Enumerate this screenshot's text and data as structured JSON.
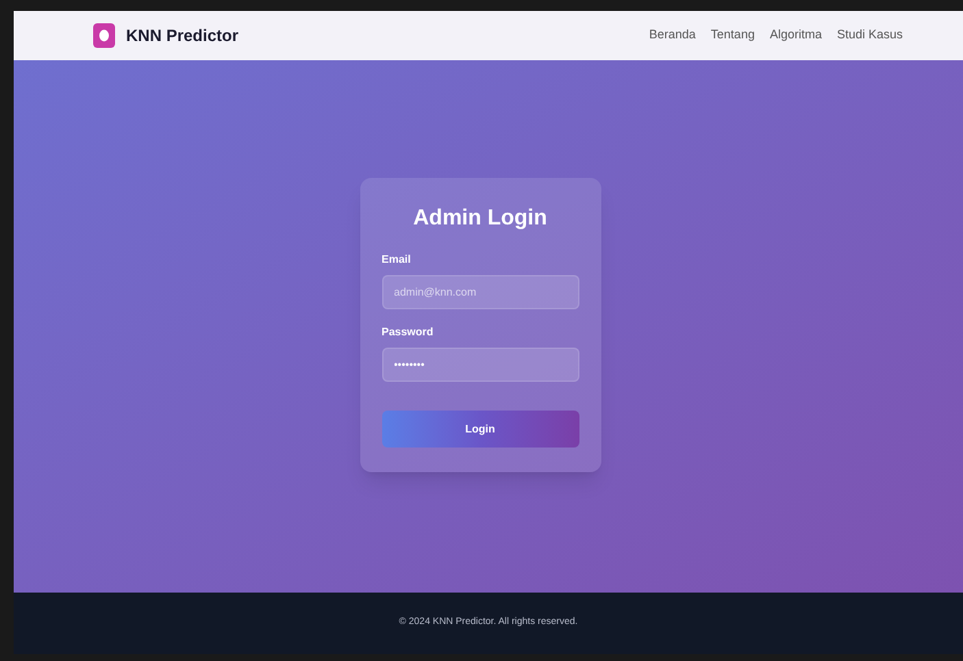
{
  "brand": {
    "name": "KNN Predictor"
  },
  "nav": [
    {
      "label": "Beranda"
    },
    {
      "label": "Tentang"
    },
    {
      "label": "Algoritma"
    },
    {
      "label": "Studi Kasus"
    }
  ],
  "login": {
    "title": "Admin Login",
    "fields": [
      {
        "label": "Email",
        "placeholder": "admin@knn.com"
      },
      {
        "label": "Password",
        "value": "••••••••"
      }
    ],
    "button": "Login"
  },
  "footer": "© 2024 KNN Predictor. All rights reserved."
}
